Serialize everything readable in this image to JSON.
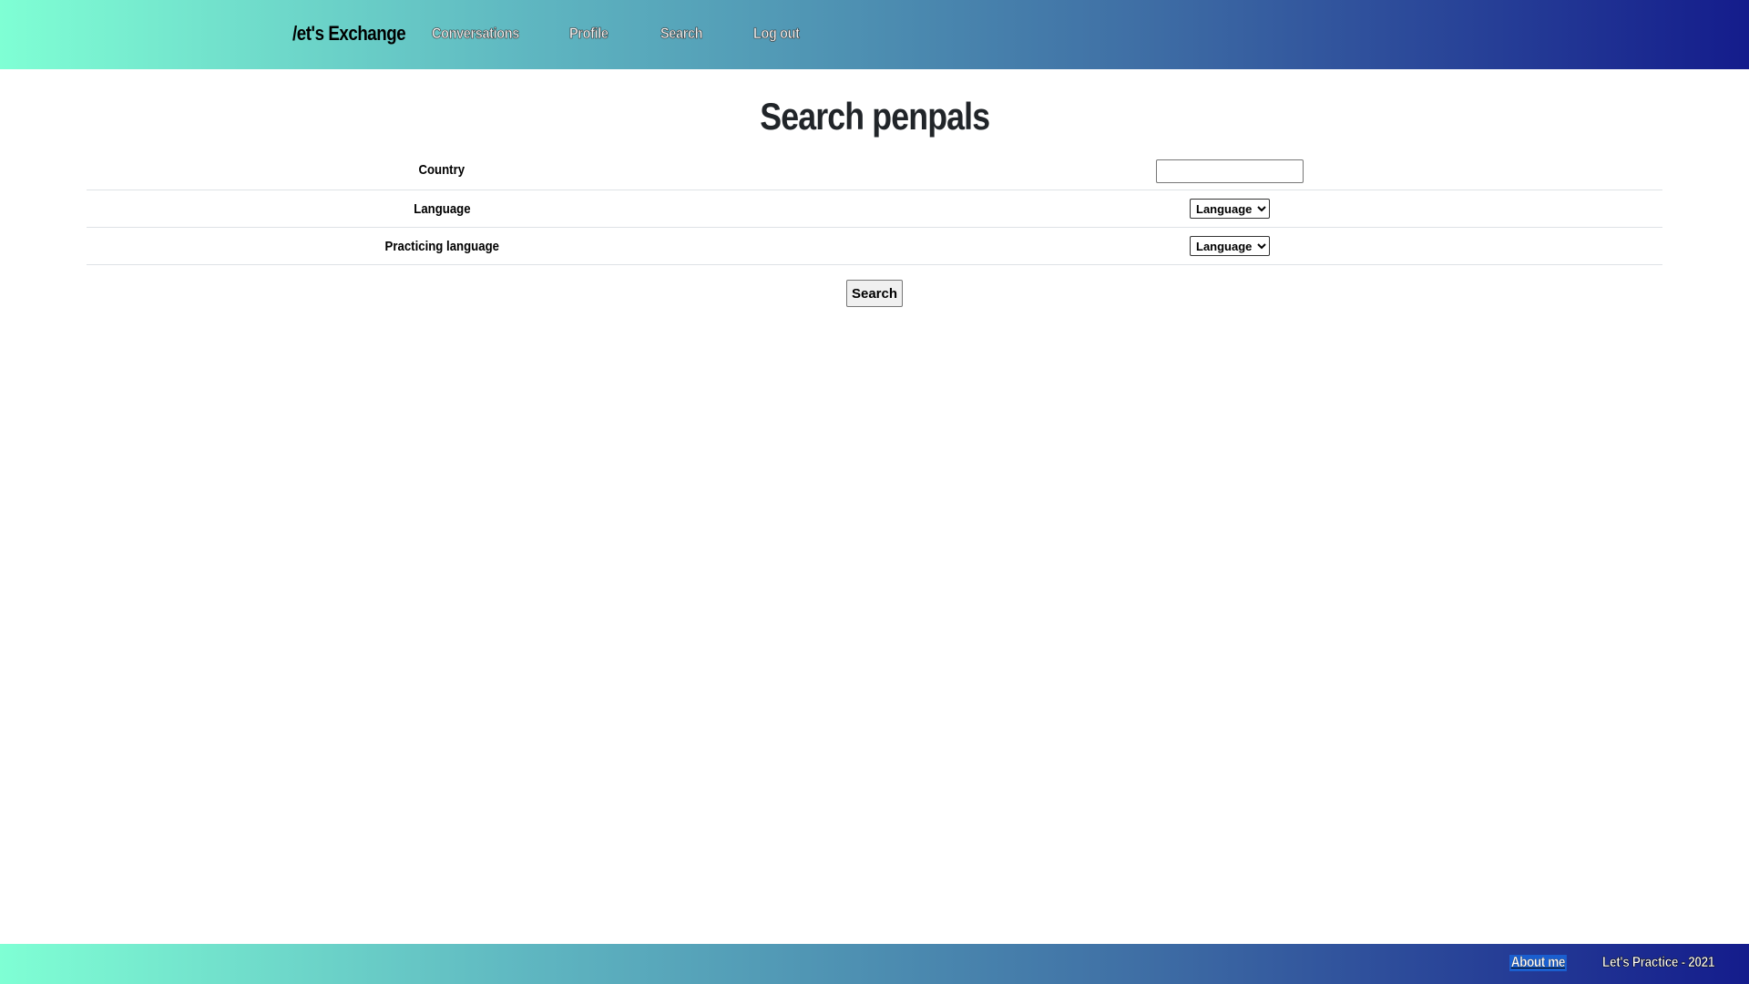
{
  "navbar": {
    "brand": "/et's Exchange",
    "links": {
      "conversations": "Conversations",
      "profile": "Profile",
      "search": "Search",
      "logout": "Log out"
    }
  },
  "main": {
    "title": "Search penpals",
    "form": {
      "country_label": "Country",
      "country_value": "",
      "language_label": "Language",
      "language_selected": "Language",
      "practicing_label": "Practicing language",
      "practicing_selected": "Language",
      "submit_label": "Search"
    }
  },
  "footer": {
    "about_link": "About me",
    "copyright": "Let's Practice - 2021"
  },
  "colors": {
    "gradient_start": "#7fffd4",
    "gradient_end": "#141c8c",
    "link_highlight": "#1a5fd0"
  }
}
